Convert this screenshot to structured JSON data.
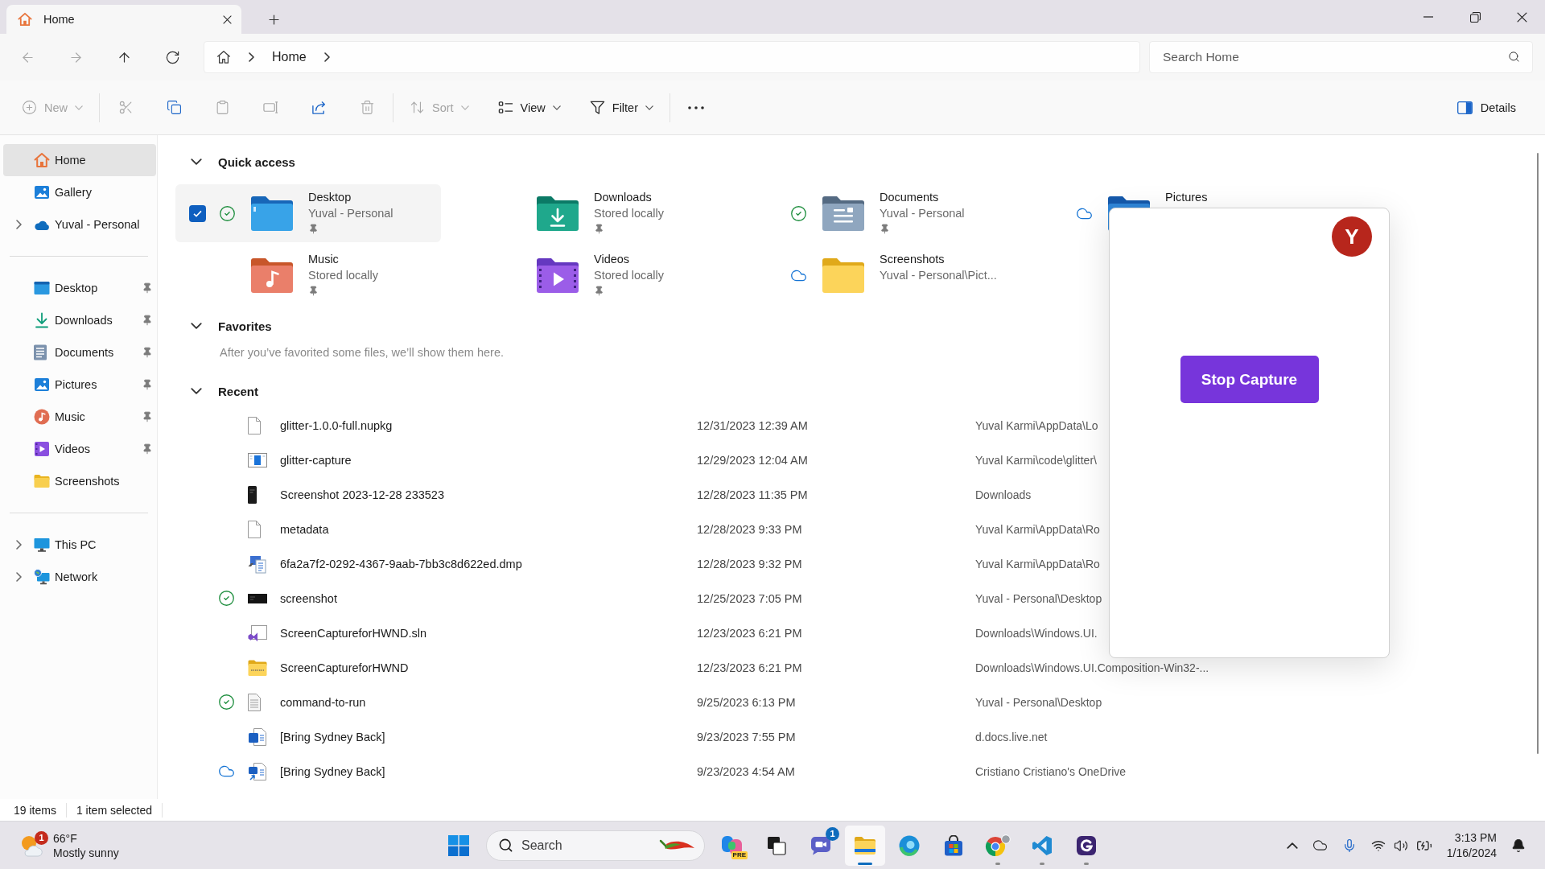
{
  "window": {
    "tabs": [
      {
        "title": "Home",
        "selected": true
      }
    ]
  },
  "address_bar": {
    "nav": [
      {
        "kind": "back",
        "disabled": true
      },
      {
        "kind": "forward",
        "disabled": true
      },
      {
        "kind": "up",
        "disabled": false
      },
      {
        "kind": "refresh",
        "disabled": false
      }
    ],
    "breadcrumbs": [
      {
        "label": "Home"
      }
    ],
    "search": {
      "placeholder": "Search Home"
    }
  },
  "toolbar": {
    "groups": [
      [
        {
          "kind": "new",
          "label": "New",
          "disabled": true,
          "menu": true
        }
      ],
      [
        {
          "kind": "cut",
          "disabled": true
        },
        {
          "kind": "copy",
          "disabled": false
        },
        {
          "kind": "paste",
          "disabled": true
        },
        {
          "kind": "rename",
          "disabled": true
        },
        {
          "kind": "share",
          "disabled": false
        },
        {
          "kind": "delete",
          "disabled": true
        }
      ],
      [
        {
          "kind": "sort",
          "label": "Sort",
          "disabled": true,
          "menu": true
        },
        {
          "kind": "view",
          "label": "View",
          "disabled": false,
          "menu": true
        },
        {
          "kind": "filter",
          "label": "Filter",
          "disabled": false,
          "menu": true
        }
      ],
      [
        {
          "kind": "more",
          "disabled": false
        }
      ]
    ],
    "details": {
      "label": "Details"
    }
  },
  "sidebar": {
    "sections": [
      {
        "items": [
          {
            "kind": "home",
            "label": "Home",
            "selected": true
          },
          {
            "kind": "gallery",
            "label": "Gallery",
            "selected": false
          },
          {
            "kind": "onedrive",
            "label": "Yuval - Personal",
            "selected": false,
            "expanded": false
          }
        ]
      },
      {
        "items": [
          {
            "kind": "desktop",
            "label": "Desktop",
            "selected": false,
            "pinned": true
          },
          {
            "kind": "downloads",
            "label": "Downloads",
            "selected": false,
            "pinned": true
          },
          {
            "kind": "documents",
            "label": "Documents",
            "selected": false,
            "pinned": true
          },
          {
            "kind": "pictures",
            "label": "Pictures",
            "selected": false,
            "pinned": true
          },
          {
            "kind": "music",
            "label": "Music",
            "selected": false,
            "pinned": true
          },
          {
            "kind": "videos",
            "label": "Videos",
            "selected": false,
            "pinned": true
          },
          {
            "kind": "folder",
            "label": "Screenshots",
            "selected": false,
            "pinned": false
          }
        ]
      },
      {
        "items": [
          {
            "kind": "pc",
            "label": "This PC",
            "selected": false,
            "expanded": false
          },
          {
            "kind": "network",
            "label": "Network",
            "selected": false,
            "expanded": false
          }
        ]
      }
    ]
  },
  "quick_access": {
    "title": "Quick access",
    "expanded": true,
    "items": [
      {
        "kind": "desktop",
        "name": "Desktop",
        "detail": "Yuval - Personal",
        "synced": true,
        "cloud_only": false,
        "pinned": true,
        "selected": true
      },
      {
        "kind": "downloads",
        "name": "Downloads",
        "detail": "Stored locally",
        "synced": false,
        "cloud_only": false,
        "pinned": true,
        "selected": false
      },
      {
        "kind": "documents",
        "name": "Documents",
        "detail": "Yuval - Personal",
        "synced": true,
        "cloud_only": false,
        "pinned": true,
        "selected": false
      },
      {
        "kind": "pictures",
        "name": "Pictures",
        "synced": false,
        "cloud_only": true,
        "selected": false
      },
      {
        "kind": "music",
        "name": "Music",
        "detail": "Stored locally",
        "synced": false,
        "cloud_only": false,
        "pinned": true,
        "selected": false
      },
      {
        "kind": "videos",
        "name": "Videos",
        "detail": "Stored locally",
        "synced": false,
        "cloud_only": false,
        "pinned": true,
        "selected": false
      },
      {
        "kind": "folder",
        "name": "Screenshots",
        "detail": "Yuval - Personal\\Pict...",
        "synced": false,
        "cloud_only": true,
        "pinned": false,
        "selected": false
      }
    ]
  },
  "favorites": {
    "title": "Favorites",
    "expanded": true,
    "empty_text": "After you’ve favorited some files, we’ll show them here."
  },
  "recent": {
    "title": "Recent",
    "expanded": true,
    "rows": [
      {
        "kind": "blank",
        "name": "glitter-1.0.0-full.nupkg",
        "date": "12/31/2023 12:39 AM",
        "location": "Yuval Karmi\\AppData\\Lo",
        "synced": false,
        "cloud_only": false
      },
      {
        "kind": "app-window",
        "name": "glitter-capture",
        "date": "12/29/2023 12:04 AM",
        "location": "Yuval Karmi\\code\\glitter\\",
        "synced": false,
        "cloud_only": false
      },
      {
        "kind": "phone-image",
        "name": "Screenshot 2023-12-28 233523",
        "date": "12/28/2023 11:35 PM",
        "location": "Downloads",
        "synced": false,
        "cloud_only": false
      },
      {
        "kind": "blank",
        "name": "metadata",
        "date": "12/28/2023 9:33 PM",
        "location": "Yuval Karmi\\AppData\\Ro",
        "synced": false,
        "cloud_only": false
      },
      {
        "kind": "dump",
        "name": "6fa2a7f2-0292-4367-9aab-7bb3c8d622ed.dmp",
        "date": "12/28/2023 9:32 PM",
        "location": "Yuval Karmi\\AppData\\Ro",
        "synced": false,
        "cloud_only": false
      },
      {
        "kind": "dark-image",
        "name": "screenshot",
        "date": "12/25/2023 7:05 PM",
        "location": "Yuval - Personal\\Desktop",
        "synced": true,
        "cloud_only": false
      },
      {
        "kind": "vs-solution",
        "name": "ScreenCaptureforHWND.sln",
        "date": "12/23/2023 6:21 PM",
        "location": "Downloads\\Windows.UI.",
        "synced": false,
        "cloud_only": false
      },
      {
        "kind": "zip-folder",
        "name": "ScreenCaptureforHWND",
        "date": "12/23/2023 6:21 PM",
        "location": "Downloads\\Windows.UI.Composition-Win32-...",
        "synced": false,
        "cloud_only": false
      },
      {
        "kind": "text",
        "name": "command-to-run",
        "date": "9/25/2023 6:13 PM",
        "location": "Yuval - Personal\\Desktop",
        "synced": true,
        "cloud_only": false
      },
      {
        "kind": "word",
        "name": "[Bring Sydney Back]",
        "date": "9/23/2023 7:55 PM",
        "location": "d.docs.live.net",
        "synced": false,
        "cloud_only": false
      },
      {
        "kind": "word-shortcut",
        "name": "[Bring Sydney Back]",
        "date": "9/23/2023 4:54 AM",
        "location": "Cristiano Cristiano's OneDrive",
        "synced": false,
        "cloud_only": true
      }
    ]
  },
  "status_bar": {
    "item_count": "19 items",
    "selection": "1 item selected"
  },
  "popup": {
    "avatar": "Y",
    "button": "Stop Capture"
  },
  "taskbar": {
    "weather": {
      "badge": "1",
      "temperature": "66°F",
      "condition": "Mostly sunny"
    },
    "search": {
      "label": "Search"
    },
    "apps": [
      {
        "kind": "copilot",
        "tag": "PRE",
        "running": false,
        "selected": false
      },
      {
        "kind": "task-view",
        "running": false,
        "selected": false
      },
      {
        "kind": "chat",
        "badge": "1",
        "running": false,
        "selected": false
      },
      {
        "kind": "explorer",
        "running": true,
        "selected": true
      },
      {
        "kind": "edge",
        "running": false,
        "selected": false
      },
      {
        "kind": "store",
        "running": false,
        "selected": false
      },
      {
        "kind": "chrome",
        "running": true,
        "selected": false
      },
      {
        "kind": "vscode",
        "running": true,
        "selected": false
      },
      {
        "kind": "glitter",
        "running": true,
        "selected": false
      }
    ],
    "clock": {
      "time": "3:13 PM",
      "date": "1/16/2024"
    }
  }
}
